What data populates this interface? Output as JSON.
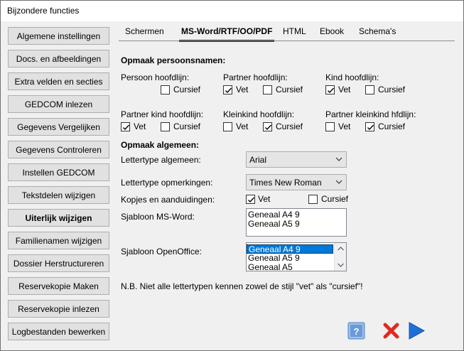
{
  "window": {
    "title": "Bijzondere functies"
  },
  "nav": [
    {
      "label": "Algemene instellingen",
      "bold": false
    },
    {
      "label": "Docs. en afbeeldingen",
      "bold": false
    },
    {
      "label": "Extra velden en secties",
      "bold": false
    },
    {
      "label": "GEDCOM inlezen",
      "bold": false
    },
    {
      "label": "Gegevens Vergelijken",
      "bold": false
    },
    {
      "label": "Gegevens Controleren",
      "bold": false
    },
    {
      "label": "Instellen GEDCOM",
      "bold": false
    },
    {
      "label": "Tekstdelen wijzigen",
      "bold": false
    },
    {
      "label": "Uiterlijk wijzigen",
      "bold": true
    },
    {
      "label": "Familienamen wijzigen",
      "bold": false
    },
    {
      "label": "Dossier Herstructureren",
      "bold": false
    },
    {
      "label": "Reservekopie Maken",
      "bold": false
    },
    {
      "label": "Reservekopie inlezen",
      "bold": false
    },
    {
      "label": "Logbestanden bewerken",
      "bold": false
    }
  ],
  "tabs": [
    "Schermen",
    "MS-Word/RTF/OO/PDF",
    "HTML",
    "Ebook",
    "Schema's"
  ],
  "active_tab": "MS-Word/RTF/OO/PDF",
  "names_section": {
    "heading": "Opmaak persoonsnamen:",
    "groups": [
      {
        "label": "Persoon hoofdlijn:",
        "vet": null,
        "cursief": false
      },
      {
        "label": "Partner hoofdlijn:",
        "vet": true,
        "cursief": false
      },
      {
        "label": "Kind hoofdlijn:",
        "vet": true,
        "cursief": false
      },
      {
        "label": "Partner kind hoofdlijn:",
        "vet": true,
        "cursief": false
      },
      {
        "label": "Kleinkind hoofdlijn:",
        "vet": false,
        "cursief": true
      },
      {
        "label": "Partner kleinkind hfdlijn:",
        "vet": false,
        "cursief": true
      }
    ],
    "vet_label": "Vet",
    "cursief_label": "Cursief"
  },
  "general_section": {
    "heading": "Opmaak algemeen:",
    "font_general_label": "Lettertype algemeen:",
    "font_general_value": "Arial",
    "font_notes_label": "Lettertype opmerkingen:",
    "font_notes_value": "Times New Roman",
    "headings_label": "Kopjes en aanduidingen:",
    "headings_vet": true,
    "headings_cursief": false,
    "template_word_label": "Sjabloon MS-Word:",
    "template_word_items": [
      "Geneaal A4 9",
      "Geneaal A5 9"
    ],
    "template_oo_label": "Sjabloon OpenOffice:",
    "template_oo_items": [
      "Geneaal A4 9",
      "Geneaal A5 9",
      "Geneaal A5"
    ],
    "template_oo_selected": 0
  },
  "note": "N.B. Niet alle lettertypen kennen zowel de stijl \"vet\" als \"cursief\"!",
  "colors": {
    "accent_blue": "#1e6fd9",
    "close_red": "#e02a20",
    "help_blue": "#5b8fd0"
  }
}
